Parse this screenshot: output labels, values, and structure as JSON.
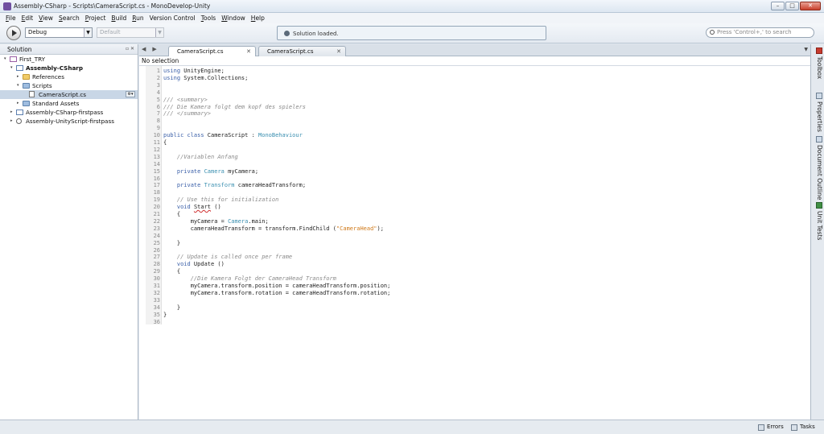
{
  "window": {
    "title": "Assembly-CSharp - Scripts\\CameraScript.cs - MonoDevelop-Unity",
    "buttons": {
      "minimize": "–",
      "maximize": "□",
      "close": "✕"
    }
  },
  "menu": [
    {
      "acc": "F",
      "rest": "ile"
    },
    {
      "acc": "E",
      "rest": "dit"
    },
    {
      "acc": "V",
      "rest": "iew"
    },
    {
      "acc": "S",
      "rest": "earch"
    },
    {
      "acc": "P",
      "rest": "roject"
    },
    {
      "acc": "B",
      "rest": "uild"
    },
    {
      "acc": "R",
      "rest": "un"
    },
    {
      "acc": "",
      "rest": "Version Control"
    },
    {
      "acc": "T",
      "rest": "ools"
    },
    {
      "acc": "W",
      "rest": "indow"
    },
    {
      "acc": "H",
      "rest": "elp"
    }
  ],
  "toolbar": {
    "config": "Debug",
    "platform": "Default",
    "status": "Solution loaded.",
    "search_placeholder": "Press 'Control+,' to search"
  },
  "solution": {
    "header": "Solution",
    "pins": "▫ ✕",
    "items": [
      {
        "label": "First_TRY",
        "indent": 0,
        "icon": "sol",
        "expander": "▾",
        "bold": false
      },
      {
        "label": "Assembly-CSharp",
        "indent": 1,
        "icon": "proj",
        "expander": "▾",
        "bold": true
      },
      {
        "label": "References",
        "indent": 2,
        "icon": "folder",
        "expander": "▸",
        "bold": false
      },
      {
        "label": "Scripts",
        "indent": 2,
        "icon": "folder-blue",
        "expander": "▾",
        "bold": false
      },
      {
        "label": "CameraScript.cs",
        "indent": 3,
        "icon": "file",
        "expander": "",
        "bold": false,
        "selected": true
      },
      {
        "label": "Standard Assets",
        "indent": 2,
        "icon": "folder-blue",
        "expander": "▸",
        "bold": false
      },
      {
        "label": "Assembly-CSharp-firstpass",
        "indent": 1,
        "icon": "proj",
        "expander": "▸",
        "bold": false
      },
      {
        "label": "Assembly-UnityScript-firstpass",
        "indent": 1,
        "icon": "asm",
        "expander": "▸",
        "bold": false
      }
    ]
  },
  "tabs": [
    {
      "label": "CameraScript.cs",
      "active": true,
      "close": "✕"
    },
    {
      "label": "CameraScript.cs",
      "active": false,
      "close": "✕"
    }
  ],
  "editor": {
    "selection_label": "No selection",
    "lines": [
      [
        [
          "kw",
          "using"
        ],
        [
          "pl",
          " UnityEngine;"
        ]
      ],
      [
        [
          "kw",
          "using"
        ],
        [
          "pl",
          " System.Collections;"
        ]
      ],
      [],
      [],
      [
        [
          "cm",
          "/// <summary>"
        ]
      ],
      [
        [
          "cm",
          "/// Die Kamera folgt dem kopf des spielers"
        ]
      ],
      [
        [
          "cm",
          "/// </summary>"
        ]
      ],
      [],
      [],
      [
        [
          "kw",
          "public class"
        ],
        [
          "pl",
          " CameraScript : "
        ],
        [
          "ty",
          "MonoBehaviour"
        ]
      ],
      [
        [
          "pl",
          "{"
        ]
      ],
      [],
      [
        [
          "pl",
          "    "
        ],
        [
          "cm",
          "//Variablen Anfang"
        ]
      ],
      [],
      [
        [
          "pl",
          "    "
        ],
        [
          "kw",
          "private"
        ],
        [
          "pl",
          " "
        ],
        [
          "ty",
          "Camera"
        ],
        [
          "pl",
          " myCamera;"
        ]
      ],
      [],
      [
        [
          "pl",
          "    "
        ],
        [
          "kw",
          "private"
        ],
        [
          "pl",
          " "
        ],
        [
          "ty",
          "Transform"
        ],
        [
          "pl",
          " cameraHeadTransform;"
        ]
      ],
      [],
      [
        [
          "pl",
          "    "
        ],
        [
          "cm",
          "// Use this for initialization"
        ]
      ],
      [
        [
          "pl",
          "    "
        ],
        [
          "kw",
          "void"
        ],
        [
          "pl",
          " "
        ],
        [
          "sq",
          "Start"
        ],
        [
          "pl",
          " ()"
        ]
      ],
      [
        [
          "pl",
          "    {"
        ]
      ],
      [
        [
          "pl",
          "        myCamera = "
        ],
        [
          "ty",
          "Camera"
        ],
        [
          "pl",
          ".main;"
        ]
      ],
      [
        [
          "pl",
          "        cameraHeadTransform = transform.FindChild ("
        ],
        [
          "st",
          "\"CameraHead\""
        ],
        [
          "pl",
          ");"
        ]
      ],
      [],
      [
        [
          "pl",
          "    }"
        ]
      ],
      [],
      [
        [
          "pl",
          "    "
        ],
        [
          "cm",
          "// Update is called once per frame"
        ]
      ],
      [
        [
          "pl",
          "    "
        ],
        [
          "kw",
          "void"
        ],
        [
          "pl",
          " Update ()"
        ]
      ],
      [
        [
          "pl",
          "    {"
        ]
      ],
      [
        [
          "pl",
          "        "
        ],
        [
          "cm",
          "//Die Kamera Folgt der CameraHead Transform"
        ]
      ],
      [
        [
          "pl",
          "        myCamera.transform.position = cameraHeadTransform.position;"
        ]
      ],
      [
        [
          "pl",
          "        myCamera.transform.rotation = cameraHeadTransform.rotation;"
        ]
      ],
      [],
      [
        [
          "pl",
          "    }"
        ]
      ],
      [
        [
          "pl",
          "}"
        ]
      ],
      []
    ]
  },
  "right_pads": [
    {
      "label": "Toolbox",
      "icon": "red"
    },
    {
      "label": "Properties",
      "icon": ""
    },
    {
      "label": "Document Outline",
      "icon": ""
    },
    {
      "label": "Unit Tests",
      "icon": "green"
    }
  ],
  "statusbar": {
    "errors": "Errors",
    "tasks": "Tasks"
  }
}
